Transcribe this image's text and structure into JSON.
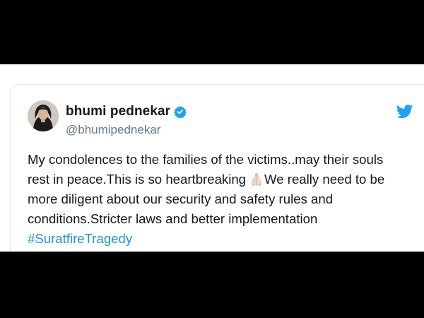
{
  "author": {
    "display_name": "bhumi pednekar",
    "handle": "@bhumipednekar",
    "verified": true
  },
  "tweet": {
    "line1": "My condolences to the families of the victims..may their souls",
    "line2_before_emoji": "rest in peace.This is so heartbreaking",
    "emoji": "folded-hands-icon",
    "line2_after_emoji": "We really need to be",
    "line3": "more diligent about our security and safety rules and",
    "line4": "conditions.Stricter laws and better implementation",
    "hashtag": "#SuratfireTragedy"
  },
  "colors": {
    "accent": "#1b95e0",
    "twitter_blue": "#1da1f2",
    "text": "#14171a",
    "secondary_text": "#657786",
    "letterbox": "#000000"
  },
  "icons": {
    "brand": "twitter-bird-icon",
    "verified": "verified-badge-icon"
  }
}
